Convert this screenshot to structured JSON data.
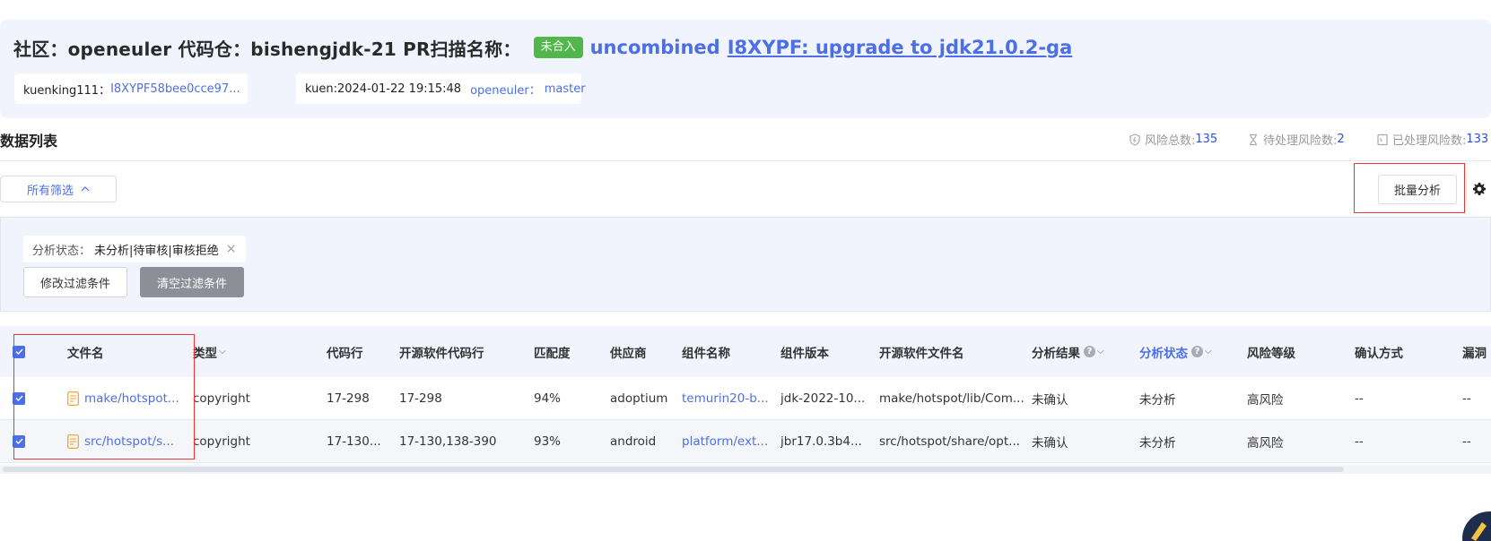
{
  "header": {
    "title": "社区：openeuler   代码仓：bishengjdk-21   PR扫描名称：",
    "badge": "未合入",
    "status": "uncombined",
    "pr_title": "I8XYPF: upgrade to jdk21.0.2-ga",
    "card1": {
      "user": "kuenking111：",
      "commit": "I8XYPF58bee0cce97..."
    },
    "card2": {
      "info": "kuen:2024-01-22 19:15:48",
      "repo": "openeuler：",
      "branch": "master"
    }
  },
  "list": {
    "title": "数据列表",
    "stats": [
      {
        "label": "风险总数:",
        "value": "135",
        "icon": "shield-icon"
      },
      {
        "label": "待处理风险数:",
        "value": "2",
        "icon": "hourglass-icon"
      },
      {
        "label": "已处理风险数:",
        "value": "133",
        "icon": "clipboard-icon"
      }
    ]
  },
  "toolbar": {
    "filter_label": "所有筛选",
    "batch_label": "批量分析"
  },
  "filter": {
    "tag_key": "分析状态：",
    "tag_value": "未分析|待审核|审核拒绝",
    "modify_label": "修改过滤条件",
    "clear_label": "清空过滤条件"
  },
  "table": {
    "headers": [
      "文件名",
      "类型",
      "代码行",
      "开源软件代码行",
      "匹配度",
      "供应商",
      "组件名称",
      "组件版本",
      "开源软件文件名",
      "分析结果",
      "分析状态",
      "风险等级",
      "确认方式",
      "漏洞"
    ],
    "rows": [
      [
        "make/hotspot...",
        "copyright",
        "17-298",
        "17-298",
        "94%",
        "adoptium",
        "temurin20-b...",
        "jdk-2022-10...",
        "make/hotspot/lib/Com...",
        "未确认",
        "未分析",
        "高风险",
        "--",
        "--"
      ],
      [
        "src/hotspot/s...",
        "copyright",
        "17-130...",
        "17-130,138-390",
        "93%",
        "android",
        "platform/ext...",
        "jbr17.0.3b4...",
        "src/hotspot/share/opt...",
        "未确认",
        "未分析",
        "高风险",
        "--",
        "--"
      ]
    ]
  },
  "colors": {
    "accent": "#4c6fe6",
    "badge": "#52b74a",
    "highlight": "#ee3333"
  }
}
